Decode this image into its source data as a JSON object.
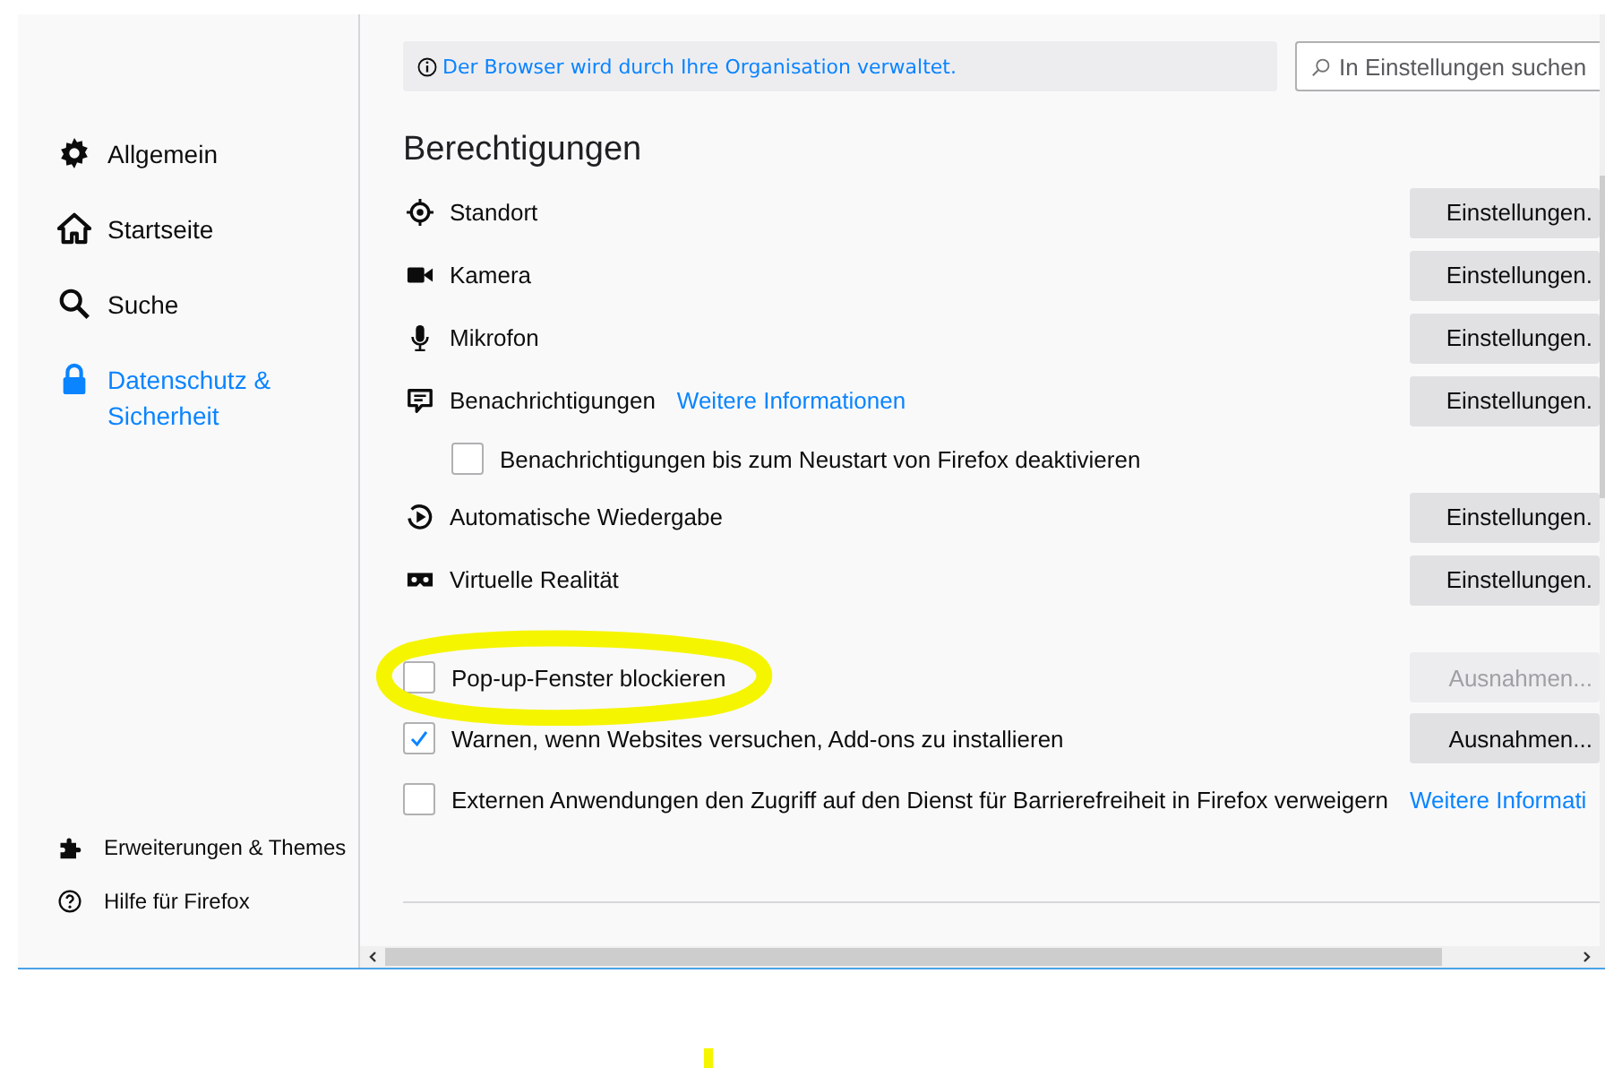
{
  "notice": "Der Browser wird durch Ihre Organisation verwaltet.",
  "search": {
    "placeholder": "In Einstellungen suchen"
  },
  "sidebar": {
    "items": [
      {
        "kind": "general",
        "label": "Allgemein",
        "selected": false
      },
      {
        "kind": "home",
        "label": "Startseite",
        "selected": false
      },
      {
        "kind": "search",
        "label": "Suche",
        "selected": false
      },
      {
        "kind": "privacy",
        "label": "Datenschutz & Sicherheit",
        "selected": true
      }
    ],
    "footer": [
      {
        "kind": "addons",
        "label": "Erweiterungen & Themes"
      },
      {
        "kind": "help",
        "label": "Hilfe für Firefox"
      }
    ]
  },
  "section": {
    "title": "Berechtigungen",
    "permissions": [
      {
        "kind": "location",
        "label": "Standort",
        "button": "Einstellungen."
      },
      {
        "kind": "camera",
        "label": "Kamera",
        "button": "Einstellungen."
      },
      {
        "kind": "microphone",
        "label": "Mikrofon",
        "button": "Einstellungen."
      },
      {
        "kind": "notifications",
        "label": "Benachrichtigungen",
        "link": "Weitere Informationen",
        "button": "Einstellungen."
      },
      {
        "kind": "checkbox",
        "label": "Benachrichtigungen bis zum Neustart von Firefox deaktivieren",
        "checked": false
      },
      {
        "kind": "autoplay",
        "label": "Automatische Wiedergabe",
        "button": "Einstellungen."
      },
      {
        "kind": "vr",
        "label": "Virtuelle Realität",
        "button": "Einstellungen."
      }
    ],
    "options": [
      {
        "label": "Pop-up-Fenster blockieren",
        "checked": false,
        "highlighted": true,
        "button": {
          "label": "Ausnahmen...",
          "disabled": true
        }
      },
      {
        "label": "Warnen, wenn Websites versuchen, Add-ons zu installieren",
        "checked": true,
        "highlighted": false,
        "button": {
          "label": "Ausnahmen...",
          "disabled": false
        }
      },
      {
        "label": "Externen Anwendungen den Zugriff auf den Dienst für Barrierefreiheit in Firefox verweigern",
        "checked": false,
        "highlighted": false,
        "link": "Weitere Informati"
      }
    ]
  }
}
